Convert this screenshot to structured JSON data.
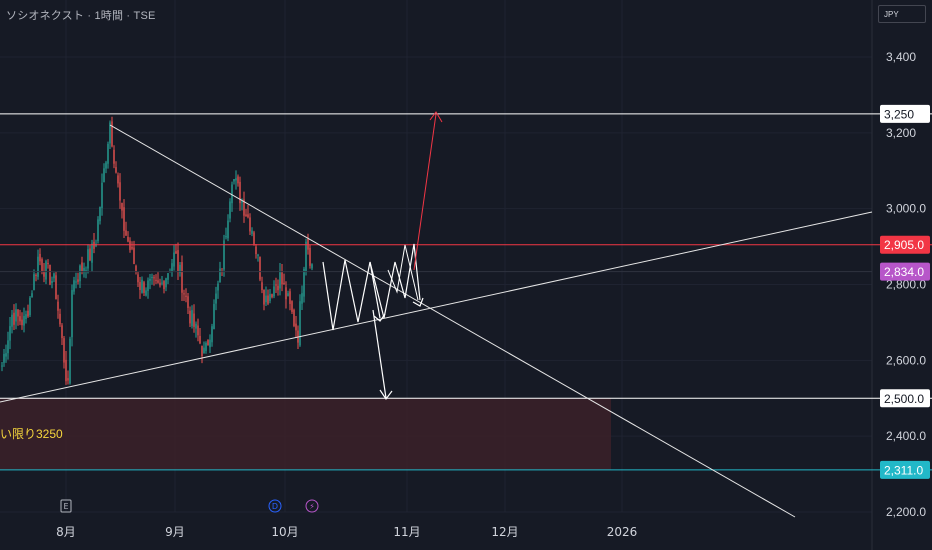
{
  "header": {
    "title": "ソシオネクスト · 1時間 · TSE",
    "currency": "JPY"
  },
  "colors": {
    "background": "#161a25",
    "grid": "#1f2331",
    "up": "#26a69a",
    "down": "#ef5350",
    "text": "#d1d4dc",
    "resistance": "#f23645",
    "support_purple": "#b756c9",
    "support_teal": "#22b8c8",
    "zone_fill": "#3b2129",
    "annotation": "#f5d63c"
  },
  "annotation_text": "い限り3250",
  "chart_data": {
    "type": "candlestick",
    "instrument": "ソシオネクスト",
    "interval": "1時間",
    "exchange": "TSE",
    "y_axis_ticks": [
      "3,400",
      "3,200",
      "3,000.0",
      "2,800.0",
      "2,600.0",
      "2,400.0",
      "2,200.0"
    ],
    "y_axis_values": [
      3400,
      3200,
      3000,
      2800,
      2600,
      2400,
      2200
    ],
    "ylim": [
      2180,
      3510
    ],
    "x_axis_ticks": [
      "8月",
      "9月",
      "10月",
      "11月",
      "12月",
      "2026"
    ],
    "horizontal_levels": [
      {
        "value": 3250,
        "label": "3,250",
        "color": "#ffffff"
      },
      {
        "value": 2905,
        "label": "2,905.0",
        "color": "#f23645"
      },
      {
        "value": 2834,
        "label": "2,834.0",
        "color": "#b756c9"
      },
      {
        "value": 2500,
        "label": "2,500.0",
        "color": "#ffffff"
      },
      {
        "value": 2311,
        "label": "2,311.0",
        "color": "#22b8c8"
      }
    ],
    "event_markers": [
      "E",
      "D",
      "⚡"
    ],
    "price_range_approx": {
      "low": 2520,
      "high": 3230,
      "last": 2834
    }
  }
}
